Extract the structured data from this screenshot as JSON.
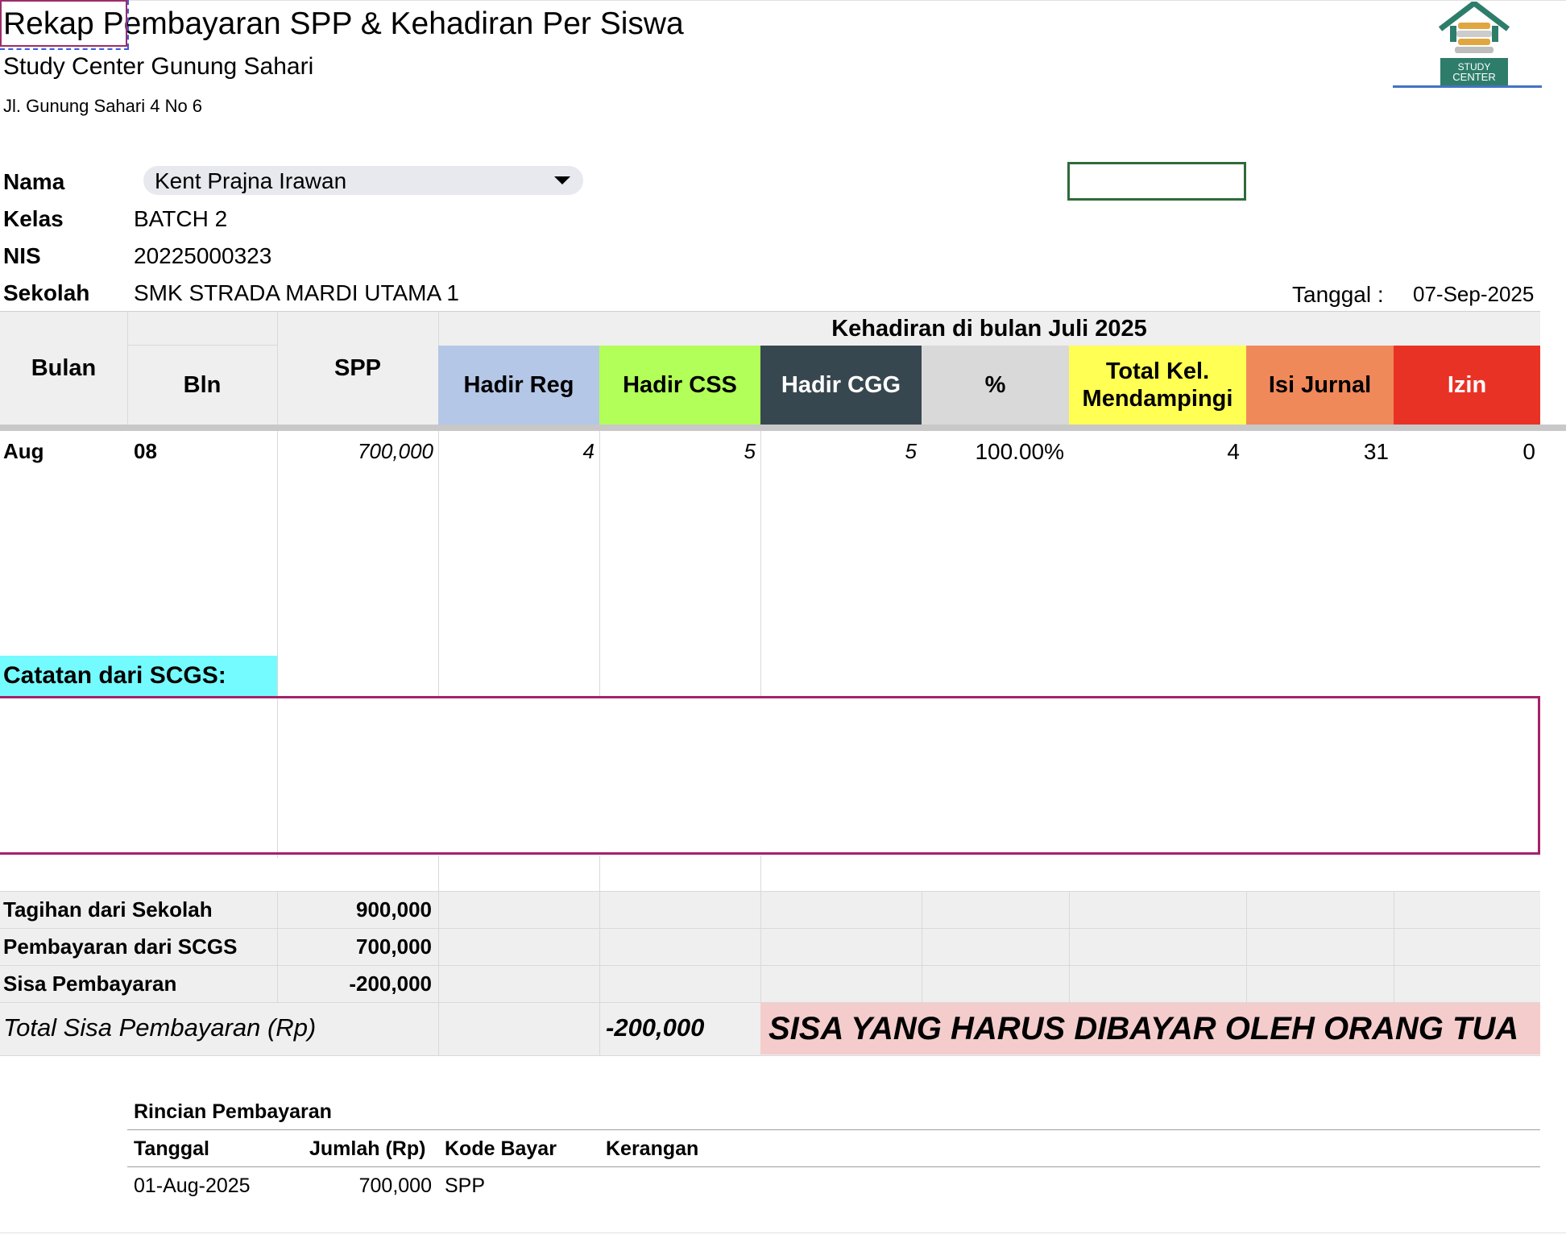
{
  "header": {
    "title": "Rekap Pembayaran SPP & Kehadiran Per Siswa",
    "org_name": "Study Center Gunung Sahari",
    "address": "Jl. Gunung Sahari 4 No 6",
    "logo_text_1": "STUDY",
    "logo_text_2": "CENTER"
  },
  "student": {
    "labels": {
      "name": "Nama",
      "class": "Kelas",
      "nis": "NIS",
      "school": "Sekolah"
    },
    "name": "Kent Prajna Irawan",
    "class": "BATCH 2",
    "nis": "20225000323",
    "school": "SMK STRADA MARDI UTAMA 1",
    "date_label": "Tanggal :",
    "date": "07-Sep-2025"
  },
  "table": {
    "col_bulan": "Bulan",
    "col_bln": "Bln",
    "col_spp": "SPP",
    "group_title": "Kehadiran di bulan Juli 2025",
    "cols": {
      "hadir_reg": "Hadir Reg",
      "hadir_css": "Hadir CSS",
      "hadir_cgg": "Hadir CGG",
      "percent": "%",
      "total_kel_1": "Total Kel.",
      "total_kel_2": "Mendampingi",
      "isi_jurnal": "Isi Jurnal",
      "izin": "Izin"
    },
    "colors": {
      "hadir_reg": "#b4c7e7",
      "hadir_css": "#b2ff59",
      "hadir_cgg": "#37474f",
      "percent": "#d9d9d9",
      "total_kel": "#ffff54",
      "isi_jurnal": "#f0895a",
      "izin": "#e93226"
    },
    "row": {
      "bulan": "Aug",
      "bln": "08",
      "spp": "700,000",
      "hadir_reg": "4",
      "hadir_css": "5",
      "hadir_cgg": "5",
      "percent": "100.00%",
      "total_kel": "4",
      "isi_jurnal": "31",
      "izin": "0"
    }
  },
  "notes": {
    "label": "Catatan dari SCGS:",
    "content": ""
  },
  "summary": {
    "tagihan_label": "Tagihan dari Sekolah",
    "tagihan_value": "900,000",
    "pembayaran_label": "Pembayaran dari SCGS",
    "pembayaran_value": "700,000",
    "sisa_label": "Sisa Pembayaran",
    "sisa_value": "-200,000",
    "total_label": "Total Sisa Pembayaran (Rp)",
    "total_value": "-200,000",
    "banner": "SISA YANG HARUS DIBAYAR OLEH ORANG TUA"
  },
  "payments": {
    "title": "Rincian Pembayaran",
    "headers": {
      "date": "Tanggal",
      "amount": "Jumlah (Rp)",
      "code": "Kode Bayar",
      "note": "Kerangan"
    },
    "rows": [
      {
        "date": "01-Aug-2025",
        "amount": "700,000",
        "code": "SPP",
        "note": ""
      }
    ]
  }
}
